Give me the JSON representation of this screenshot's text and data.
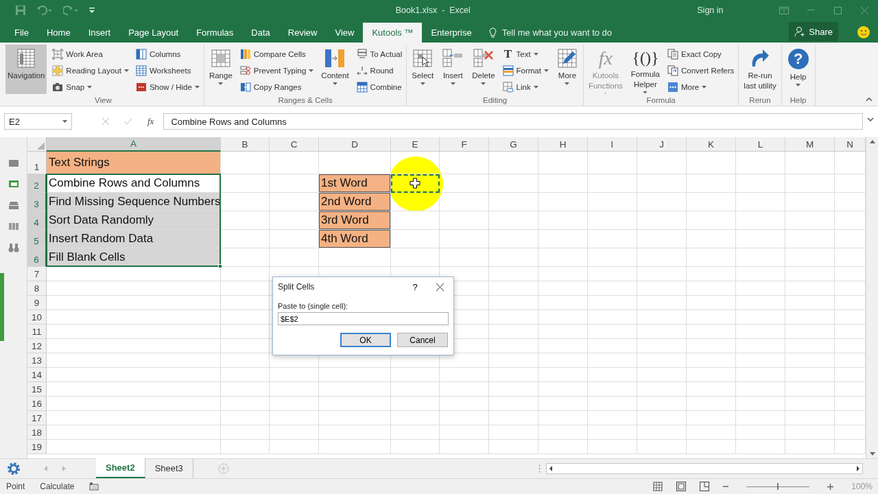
{
  "title_bar": {
    "title": "Book1.xlsx  -  Excel",
    "sign_in": "Sign in"
  },
  "menu_tabs": [
    {
      "label": "File",
      "selected": false
    },
    {
      "label": "Home",
      "selected": false
    },
    {
      "label": "Insert",
      "selected": false
    },
    {
      "label": "Page Layout",
      "selected": false
    },
    {
      "label": "Formulas",
      "selected": false
    },
    {
      "label": "Data",
      "selected": false
    },
    {
      "label": "Review",
      "selected": false
    },
    {
      "label": "View",
      "selected": false
    },
    {
      "label": "Kutools ™",
      "selected": true
    },
    {
      "label": "Enterprise",
      "selected": false
    }
  ],
  "tell_me": {
    "placeholder": "Tell me what you want to do"
  },
  "share_button": "Share",
  "ribbon_groups": [
    {
      "label": "View",
      "controls": [
        {
          "kind": "large",
          "label": "Navigation",
          "on": true,
          "disabled": false,
          "dropdown": false
        },
        {
          "kind": "stack",
          "items": [
            {
              "label": "Work Area",
              "dropdown": false
            },
            {
              "label": "Reading Layout",
              "dropdown": true
            },
            {
              "label": "Snap",
              "dropdown": true
            }
          ]
        },
        {
          "kind": "stack",
          "items": [
            {
              "label": "Columns",
              "dropdown": false
            },
            {
              "label": "Worksheets",
              "dropdown": false
            },
            {
              "label": "Show / Hide",
              "dropdown": true
            }
          ]
        }
      ]
    },
    {
      "label": "Ranges & Cells",
      "controls": [
        {
          "kind": "large",
          "label": "Range",
          "on": false,
          "disabled": false,
          "dropdown": true
        },
        {
          "kind": "stack",
          "items": [
            {
              "label": "Compare Cells",
              "dropdown": false
            },
            {
              "label": "Prevent Typing",
              "dropdown": true
            },
            {
              "label": "Copy Ranges",
              "dropdown": false
            }
          ]
        },
        {
          "kind": "large",
          "label": "Content",
          "on": false,
          "disabled": false,
          "dropdown": true
        },
        {
          "kind": "stack",
          "items": [
            {
              "label": "To Actual",
              "dropdown": false
            },
            {
              "label": "Round",
              "dropdown": false
            },
            {
              "label": "Combine",
              "dropdown": false
            }
          ]
        }
      ]
    },
    {
      "label": "Editing",
      "controls": [
        {
          "kind": "large",
          "label": "Select",
          "on": false,
          "disabled": false,
          "dropdown": true
        },
        {
          "kind": "large",
          "label": "Insert",
          "on": false,
          "disabled": false,
          "dropdown": true
        },
        {
          "kind": "large",
          "label": "Delete",
          "on": false,
          "disabled": false,
          "dropdown": true
        },
        {
          "kind": "stack",
          "items": [
            {
              "label": "Text",
              "dropdown": true,
              "glyph": "T"
            },
            {
              "label": "Format",
              "dropdown": true
            },
            {
              "label": "Link",
              "dropdown": true
            }
          ]
        },
        {
          "kind": "large",
          "label": "More",
          "on": false,
          "disabled": false,
          "dropdown": true
        }
      ]
    },
    {
      "label": "Formula",
      "controls": [
        {
          "kind": "large",
          "label": "Kutools\nFunctions",
          "on": false,
          "disabled": true,
          "dropdown": true,
          "glyph": "fx"
        },
        {
          "kind": "large",
          "label": "Formula\nHelper",
          "on": false,
          "disabled": false,
          "dropdown": true,
          "glyph": "{()}"
        },
        {
          "kind": "stack",
          "items": [
            {
              "label": "Exact Copy",
              "dropdown": false
            },
            {
              "label": "Convert Refers",
              "dropdown": false
            },
            {
              "label": "More",
              "dropdown": true
            }
          ]
        }
      ]
    },
    {
      "label": "Rerun",
      "controls": [
        {
          "kind": "large",
          "label": "Re-run\nlast utility",
          "on": false,
          "disabled": false,
          "dropdown": false
        }
      ]
    },
    {
      "label": "Help",
      "controls": [
        {
          "kind": "large",
          "label": "Help",
          "on": false,
          "disabled": false,
          "dropdown": true,
          "glyph": "?"
        }
      ]
    }
  ],
  "formula_bar": {
    "name_box": "E2",
    "fx": "fx",
    "value": "Combine Rows and Columns"
  },
  "columns": [
    {
      "label": "A",
      "selected": true
    },
    {
      "label": "B",
      "selected": false
    },
    {
      "label": "C",
      "selected": false
    },
    {
      "label": "D",
      "selected": false
    },
    {
      "label": "E",
      "selected": false
    },
    {
      "label": "F",
      "selected": false
    },
    {
      "label": "G",
      "selected": false
    },
    {
      "label": "H",
      "selected": false
    },
    {
      "label": "I",
      "selected": false
    },
    {
      "label": "J",
      "selected": false
    },
    {
      "label": "K",
      "selected": false
    },
    {
      "label": "L",
      "selected": false
    },
    {
      "label": "M",
      "selected": false
    },
    {
      "label": "N",
      "selected": false
    }
  ],
  "rows": [
    {
      "label": "1",
      "selected": false,
      "cells": {
        "col_a": {
          "text": "Text Strings",
          "color": "#f4b183"
        }
      }
    },
    {
      "label": "2",
      "selected": true,
      "cells": {
        "col_a": {
          "text": "Combine Rows and Columns",
          "selected": true,
          "active": true
        },
        "col_d": {
          "text": "1st Word",
          "color": "#f4b183",
          "bordered": true
        },
        "col_e": {
          "marquee": true
        }
      }
    },
    {
      "label": "3",
      "selected": true,
      "cells": {
        "col_a": {
          "text": "Find Missing Sequence Numbers",
          "selected": true,
          "active": false
        },
        "col_d": {
          "text": "2nd Word",
          "color": "#f4b183",
          "bordered": true
        }
      }
    },
    {
      "label": "4",
      "selected": true,
      "cells": {
        "col_a": {
          "text": "Sort Data Randomly",
          "selected": true,
          "active": false
        },
        "col_d": {
          "text": "3rd Word",
          "color": "#f4b183",
          "bordered": true
        }
      }
    },
    {
      "label": "5",
      "selected": true,
      "cells": {
        "col_a": {
          "text": "Insert Random Data",
          "selected": true,
          "active": false
        },
        "col_d": {
          "text": "4th Word",
          "color": "#f4b183",
          "bordered": true
        }
      }
    },
    {
      "label": "6",
      "selected": true,
      "cells": {
        "col_a": {
          "text": "Fill Blank Cells",
          "selected": true,
          "active": false
        }
      }
    },
    {
      "label": "7",
      "selected": false
    },
    {
      "label": "8",
      "selected": false
    },
    {
      "label": "9",
      "selected": false
    },
    {
      "label": "10",
      "selected": false
    },
    {
      "label": "11",
      "selected": false
    },
    {
      "label": "12",
      "selected": false
    },
    {
      "label": "13",
      "selected": false
    },
    {
      "label": "14",
      "selected": false
    },
    {
      "label": "15",
      "selected": false
    },
    {
      "label": "16",
      "selected": false
    },
    {
      "label": "17",
      "selected": false
    },
    {
      "label": "18",
      "selected": false
    },
    {
      "label": "19",
      "selected": false
    }
  ],
  "dialog": {
    "title": "Split Cells",
    "help": "?",
    "label": "Paste to (single cell):",
    "value": "$E$2",
    "buttons": [
      {
        "label": "OK",
        "default": true
      },
      {
        "label": "Cancel",
        "default": false
      }
    ]
  },
  "sheet_tabs": [
    {
      "label": "Sheet2",
      "selected": true
    },
    {
      "label": "Sheet3",
      "selected": false
    }
  ],
  "status_bar": {
    "mode": "Point",
    "calculate": "Calculate",
    "zoom_slider": {
      "level": 0.5
    },
    "zoom": "100%"
  }
}
